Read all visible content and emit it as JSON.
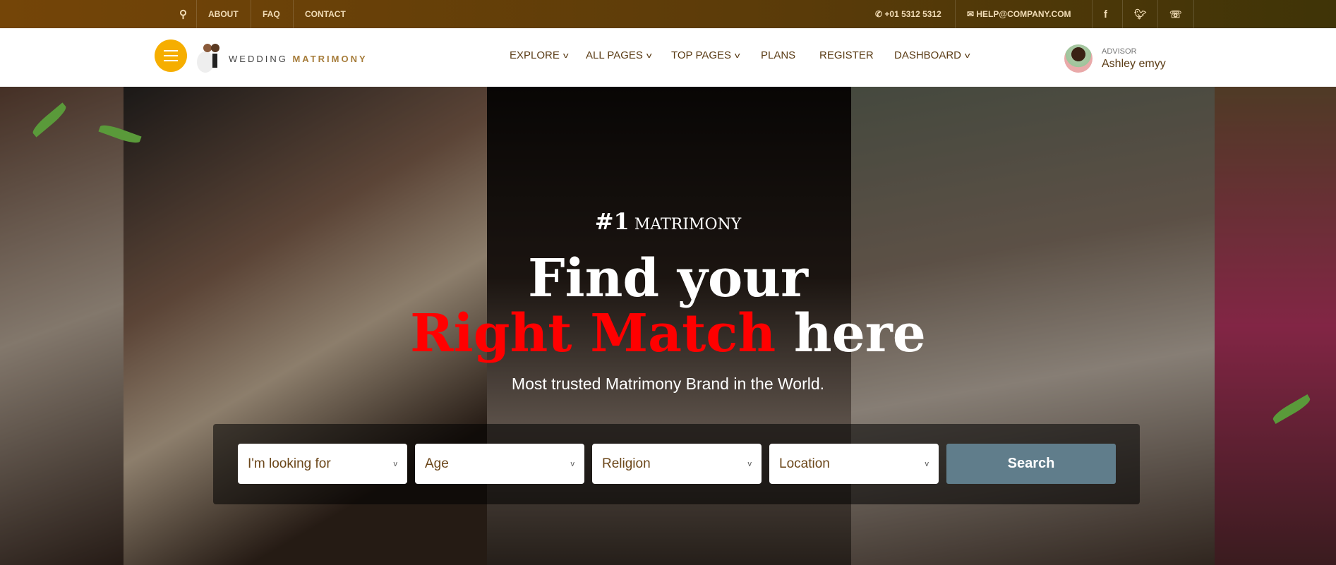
{
  "topbar": {
    "links": [
      "ABOUT",
      "FAQ",
      "CONTACT"
    ],
    "phone": "+01 5312 5312",
    "email": "HELP@COMPANY.COM"
  },
  "nav": {
    "logo_light": "WEDDING",
    "logo_bold": "MATRIMONY",
    "items": [
      {
        "label": "EXPLORE",
        "dropdown": true
      },
      {
        "label": "ALL PAGES",
        "dropdown": true
      },
      {
        "label": "TOP PAGES",
        "dropdown": true
      },
      {
        "label": "PLANS",
        "dropdown": false
      },
      {
        "label": "REGISTER",
        "dropdown": false
      },
      {
        "label": "DASHBOARD",
        "dropdown": true
      }
    ],
    "user_role": "ADVISOR",
    "user_name": "Ashley emyy"
  },
  "hero": {
    "kicker_num": "#1",
    "kicker_text": "MATRIMONY",
    "line1": "Find your",
    "highlight": "Right Match",
    "line2_rest": "here",
    "subtitle": "Most trusted Matrimony Brand in the World.",
    "highlight_color": "#ff0000"
  },
  "search": {
    "selects": [
      "I'm looking for",
      "Age",
      "Religion",
      "Location"
    ],
    "button": "Search",
    "button_color": "#607d8b"
  },
  "colors": {
    "topbar": "#744508",
    "accent": "#f6ae00",
    "nav_text": "#5a3b14"
  }
}
